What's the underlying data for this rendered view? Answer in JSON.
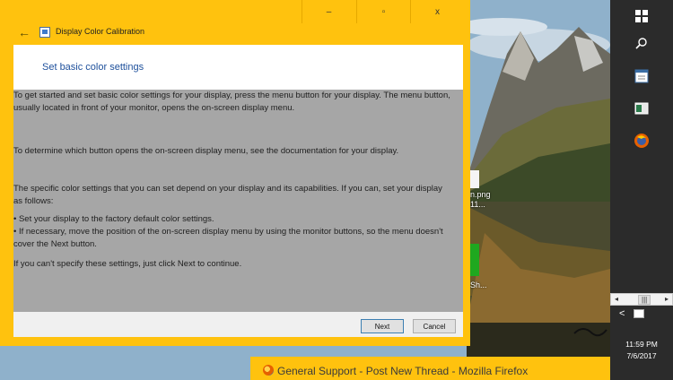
{
  "window": {
    "title": "Display Color Calibration",
    "caption_buttons": {
      "minimize": "–",
      "maximize": "▫",
      "close": "x"
    },
    "heading": "Set basic color settings",
    "paragraphs": [
      "To get started and set basic color settings for your display, press the menu button for your display. The menu button, usually located in front of your monitor, opens the on-screen display menu.",
      "To determine which button opens the on-screen display menu, see the documentation for your display.",
      "The specific color settings that you can set depend on your display and its capabilities. If you can, set your display as follows:",
      "• Set your display to the factory default color settings.",
      "• If necessary, move the position of the on-screen display menu by using the monitor buttons, so the menu doesn't cover the Next button.",
      "If you can't specify these settings,  just click Next to continue."
    ],
    "buttons": {
      "next": "Next",
      "cancel": "Cancel"
    }
  },
  "desktop": {
    "fragments": [
      "n.png",
      "11...",
      "Sh..."
    ]
  },
  "taskbar": {
    "icons": [
      "windows-start-icon",
      "search-icon",
      "notepad-icon",
      "app-window-icon",
      "firefox-icon"
    ],
    "tray_scroll_left": "◂",
    "tray_scroll_mid": "|||",
    "tray_scroll_right": "▸",
    "time": "11:59 PM",
    "date": "7/6/2017"
  },
  "popout": {
    "title": "General Support - Post New Thread - Mozilla Firefox"
  },
  "colors": {
    "accent": "#ffc20e",
    "heading": "#1d4f9b",
    "taskbar": "#2b2b2b"
  }
}
